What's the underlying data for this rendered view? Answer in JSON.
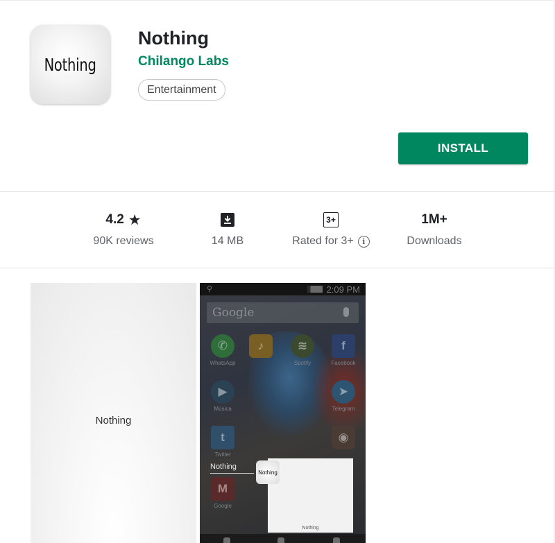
{
  "app": {
    "icon_text": "Nothing",
    "title": "Nothing",
    "developer": "Chilango Labs",
    "category": "Entertainment",
    "install_label": "INSTALL"
  },
  "stats": {
    "rating_value": "4.2",
    "rating_icon": "star-icon",
    "reviews_label": "90K reviews",
    "size_icon": "download-icon",
    "size_label": "14 MB",
    "content_rating_badge": "3+",
    "content_rating_label": "Rated for 3+",
    "info_icon": "info-icon",
    "downloads_value": "1M+",
    "downloads_label": "Downloads"
  },
  "screenshots": {
    "first_caption": "Nothing",
    "second": {
      "status_time": "2:09 PM",
      "search_placeholder": "Google",
      "apps": [
        "WhatsApp",
        "",
        "Spotify",
        "Facebook",
        "Música",
        "",
        "",
        "Telegram",
        "Twitter",
        "",
        "",
        "",
        "Google"
      ],
      "overlay_caption": "Nothing",
      "mini_icon_text": "Nothing",
      "mini_window_label": "Nothing"
    }
  },
  "colors": {
    "accent": "#01875f",
    "text_primary": "#202124",
    "text_secondary": "#5f6368"
  }
}
